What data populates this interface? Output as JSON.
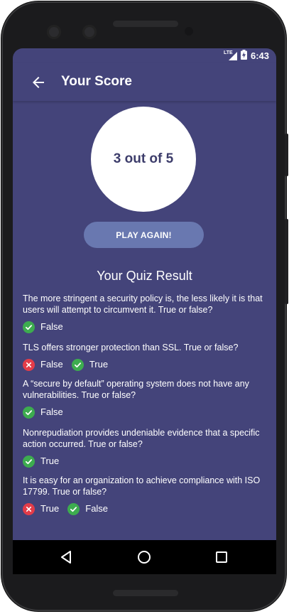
{
  "status": {
    "time": "6:43",
    "network": "LTE"
  },
  "appbar": {
    "title": "Your Score"
  },
  "score": {
    "text": "3 out of 5"
  },
  "play_again": {
    "label": "PLAY AGAIN!"
  },
  "result": {
    "heading": "Your Quiz Result",
    "questions": [
      {
        "text": "The more stringent a security policy is, the less likely it is that users will attempt to circumvent it.  True or false?",
        "answers": [
          {
            "label": "False",
            "correct": true
          }
        ]
      },
      {
        "text": "TLS offers stronger protection than SSL.  True or false?",
        "answers": [
          {
            "label": "False",
            "correct": false
          },
          {
            "label": "True",
            "correct": true
          }
        ]
      },
      {
        "text": "A “secure by default” operating system does not have any vulnerabilities.  True or false?",
        "answers": [
          {
            "label": "False",
            "correct": true
          }
        ]
      },
      {
        "text": "Nonrepudiation provides undeniable evidence that a specific action occurred.  True or false?",
        "answers": [
          {
            "label": "True",
            "correct": true
          }
        ]
      },
      {
        "text": "It is easy for an organization to achieve compliance with ISO 17799.  True or false?",
        "answers": [
          {
            "label": "True",
            "correct": false
          },
          {
            "label": "False",
            "correct": true
          }
        ]
      }
    ]
  },
  "colors": {
    "background": "#44447a",
    "button": "#6978b0",
    "correct": "#3dac4f",
    "wrong": "#e33c49"
  },
  "icons": {
    "back": "arrow-left-icon",
    "correct": "check-circle-icon",
    "wrong": "x-circle-icon",
    "nav": [
      "back-triangle-icon",
      "home-circle-icon",
      "recents-square-icon"
    ]
  }
}
